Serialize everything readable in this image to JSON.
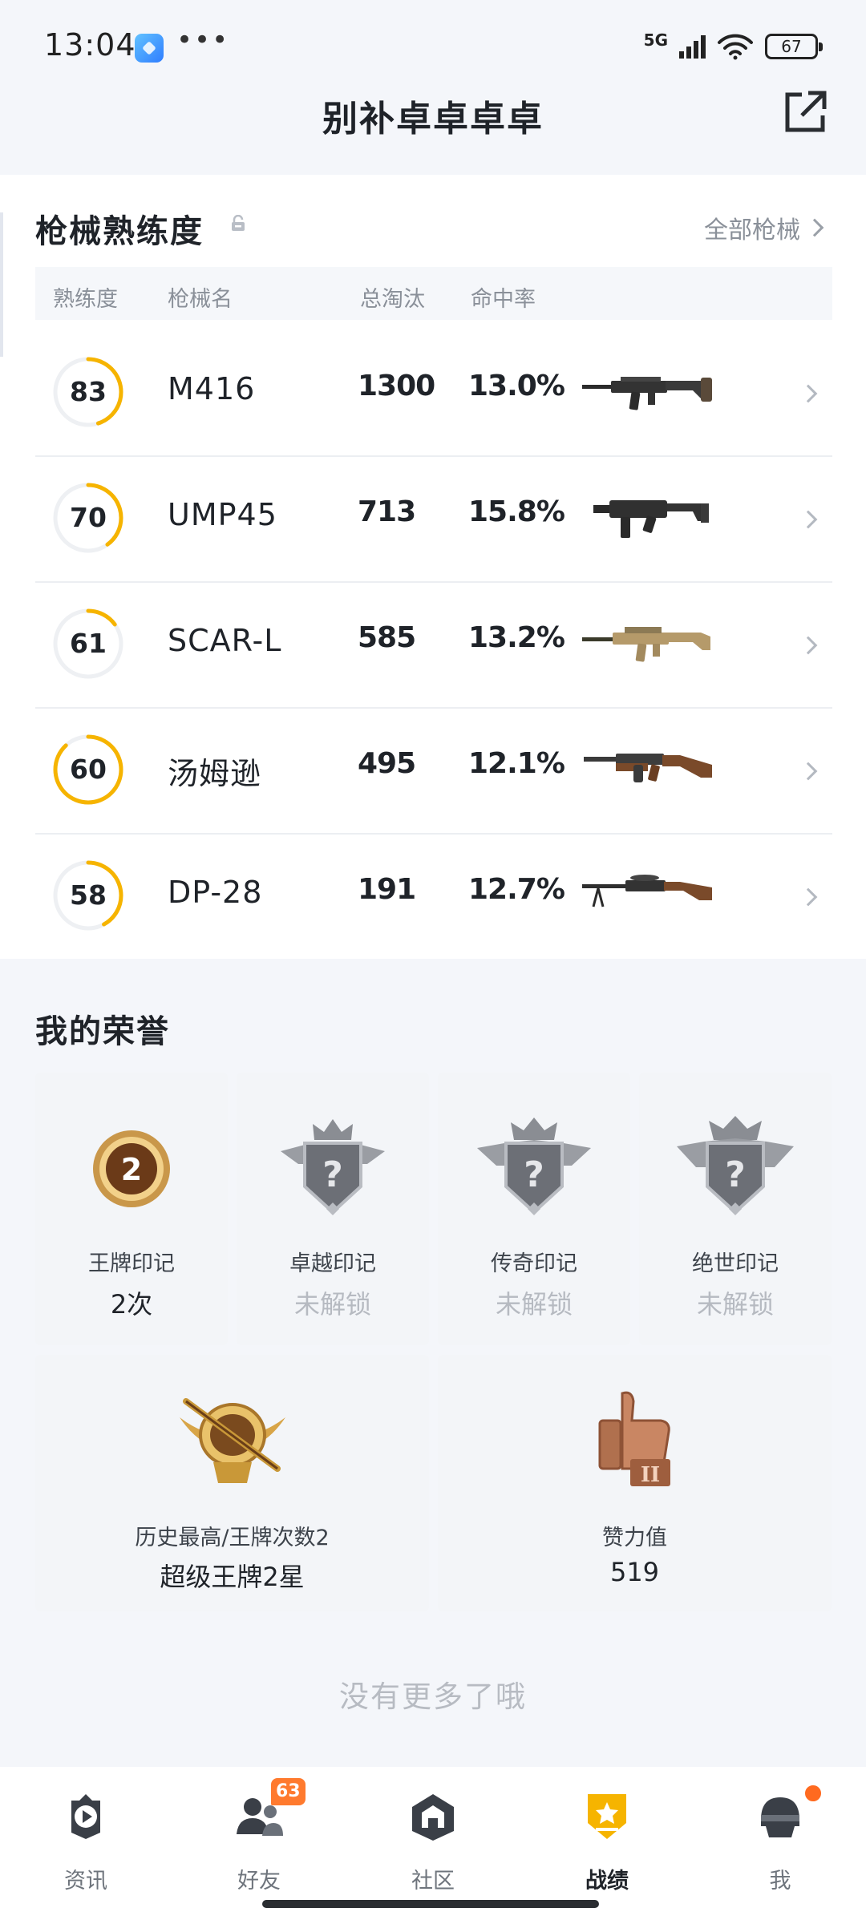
{
  "status_bar": {
    "time": "13:04",
    "more": "•••",
    "network": "5G",
    "battery": "67"
  },
  "header": {
    "title": "别补卓卓卓卓"
  },
  "weapon_section": {
    "title": "枪械熟练度",
    "all_link": "全部枪械",
    "columns": {
      "level": "熟练度",
      "name": "枪械名",
      "kills": "总淘汰",
      "accuracy": "命中率"
    },
    "rows": [
      {
        "level": "83",
        "name": "M416",
        "kills": "1300",
        "accuracy": "13.0%",
        "progress": 0.45,
        "gun_icon": "assault-rifle-icon"
      },
      {
        "level": "70",
        "name": "UMP45",
        "kills": "713",
        "accuracy": "15.8%",
        "progress": 0.4,
        "gun_icon": "smg-icon"
      },
      {
        "level": "61",
        "name": "SCAR-L",
        "kills": "585",
        "accuracy": "13.2%",
        "progress": 0.15,
        "gun_icon": "tan-rifle-icon"
      },
      {
        "level": "60",
        "name": "汤姆逊",
        "kills": "495",
        "accuracy": "12.1%",
        "progress": 0.88,
        "gun_icon": "tommy-gun-icon"
      },
      {
        "level": "58",
        "name": "DP-28",
        "kills": "191",
        "accuracy": "12.7%",
        "progress": 0.42,
        "gun_icon": "lmg-icon"
      }
    ]
  },
  "honors": {
    "title": "我的荣誉",
    "small": [
      {
        "label": "王牌印记",
        "value": "2次",
        "locked": false,
        "icon": "ace-medal-icon"
      },
      {
        "label": "卓越印记",
        "value": "未解锁",
        "locked": true,
        "icon": "locked-crest-icon"
      },
      {
        "label": "传奇印记",
        "value": "未解锁",
        "locked": true,
        "icon": "locked-crest-icon"
      },
      {
        "label": "绝世印记",
        "value": "未解锁",
        "locked": true,
        "icon": "locked-crest-icon"
      }
    ],
    "large": [
      {
        "label": "历史最高/王牌次数2",
        "value": "超级王牌2星",
        "icon": "rank-emblem-icon"
      },
      {
        "label": "赞力值",
        "value": "519",
        "icon": "thumbs-up-trophy-icon"
      }
    ]
  },
  "footer_text": "没有更多了哦",
  "bottom_nav": {
    "items": [
      {
        "label": "资讯",
        "icon": "news-icon",
        "active": false
      },
      {
        "label": "好友",
        "icon": "friends-icon",
        "badge": "63",
        "active": false
      },
      {
        "label": "社区",
        "icon": "community-icon",
        "active": false
      },
      {
        "label": "战绩",
        "icon": "record-icon",
        "active": true
      },
      {
        "label": "我",
        "icon": "profile-helmet-icon",
        "active": false
      }
    ]
  },
  "colors": {
    "accent": "#f6b400",
    "text": "#1f2329",
    "muted": "#8a9099",
    "badge": "#ff7a2e"
  }
}
